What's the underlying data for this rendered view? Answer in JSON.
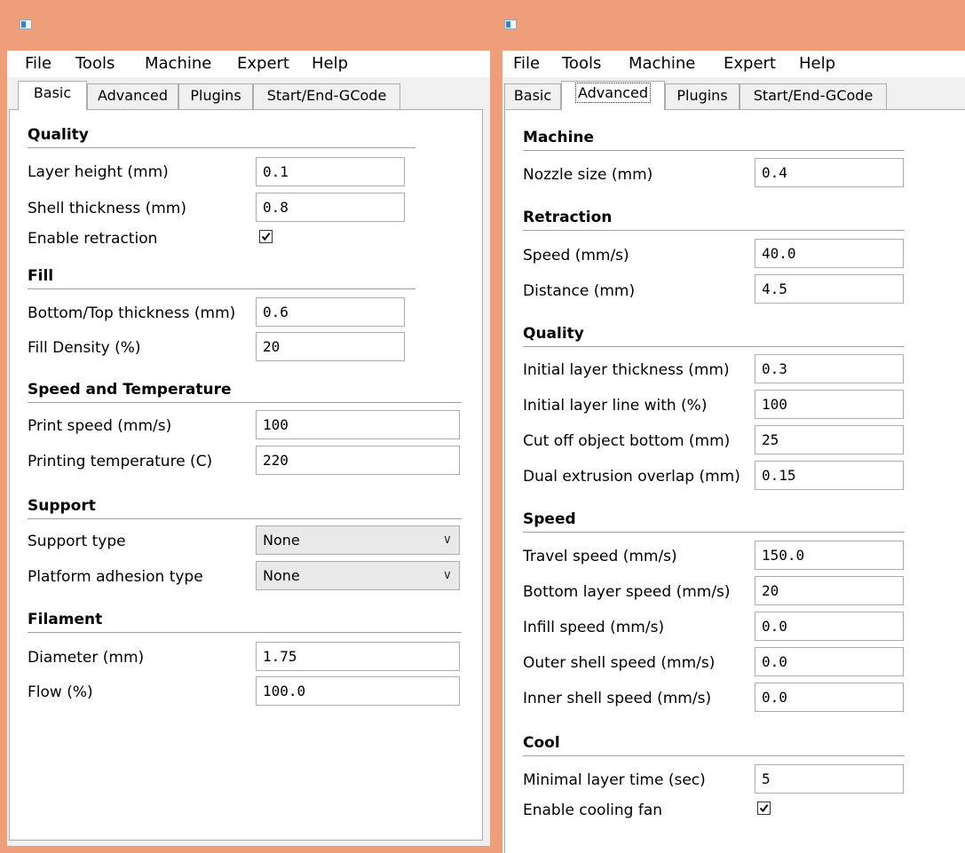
{
  "menu": [
    "File",
    "Tools",
    "Machine",
    "Expert",
    "Help"
  ],
  "tabs": [
    "Basic",
    "Advanced",
    "Plugins",
    "Start/End-GCode"
  ],
  "colors": {
    "title_bar": "#ee9f79",
    "panel": "#ffffff"
  },
  "basic": {
    "quality": {
      "title": "Quality",
      "layer_height_label": "Layer height (mm)",
      "layer_height": "0.1",
      "shell_thickness_label": "Shell thickness (mm)",
      "shell_thickness": "0.8",
      "enable_retraction_label": "Enable retraction",
      "enable_retraction": true
    },
    "fill": {
      "title": "Fill",
      "bottom_top_label": "Bottom/Top thickness (mm)",
      "bottom_top": "0.6",
      "density_label": "Fill Density (%)",
      "density": "20"
    },
    "speed_temp": {
      "title": "Speed and Temperature",
      "print_speed_label": "Print speed (mm/s)",
      "print_speed": "100",
      "temperature_label": "Printing temperature (C)",
      "temperature": "220"
    },
    "support": {
      "title": "Support",
      "type_label": "Support type",
      "type": "None",
      "adhesion_label": "Platform adhesion type",
      "adhesion": "None"
    },
    "filament": {
      "title": "Filament",
      "diameter_label": "Diameter (mm)",
      "diameter": "1.75",
      "flow_label": "Flow (%)",
      "flow": "100.0"
    }
  },
  "advanced": {
    "machine": {
      "title": "Machine",
      "nozzle_label": "Nozzle size (mm)",
      "nozzle": "0.4"
    },
    "retraction": {
      "title": "Retraction",
      "speed_label": "Speed (mm/s)",
      "speed": "40.0",
      "distance_label": "Distance (mm)",
      "distance": "4.5"
    },
    "quality": {
      "title": "Quality",
      "initial_thickness_label": "Initial layer thickness (mm)",
      "initial_thickness": "0.3",
      "initial_width_label": "Initial layer line with (%)",
      "initial_width": "100",
      "cutoff_label": "Cut off object bottom (mm)",
      "cutoff": "25",
      "dual_overlap_label": "Dual extrusion overlap (mm)",
      "dual_overlap": "0.15"
    },
    "speed": {
      "title": "Speed",
      "travel_label": "Travel speed (mm/s)",
      "travel": "150.0",
      "bottom_label": "Bottom layer speed (mm/s)",
      "bottom": "20",
      "infill_label": "Infill speed (mm/s)",
      "infill": "0.0",
      "outer_label": "Outer shell speed (mm/s)",
      "outer": "0.0",
      "inner_label": "Inner shell speed (mm/s)",
      "inner": "0.0"
    },
    "cool": {
      "title": "Cool",
      "min_layer_time_label": "Minimal layer time (sec)",
      "min_layer_time": "5",
      "fan_label": "Enable cooling fan",
      "fan": true
    }
  }
}
